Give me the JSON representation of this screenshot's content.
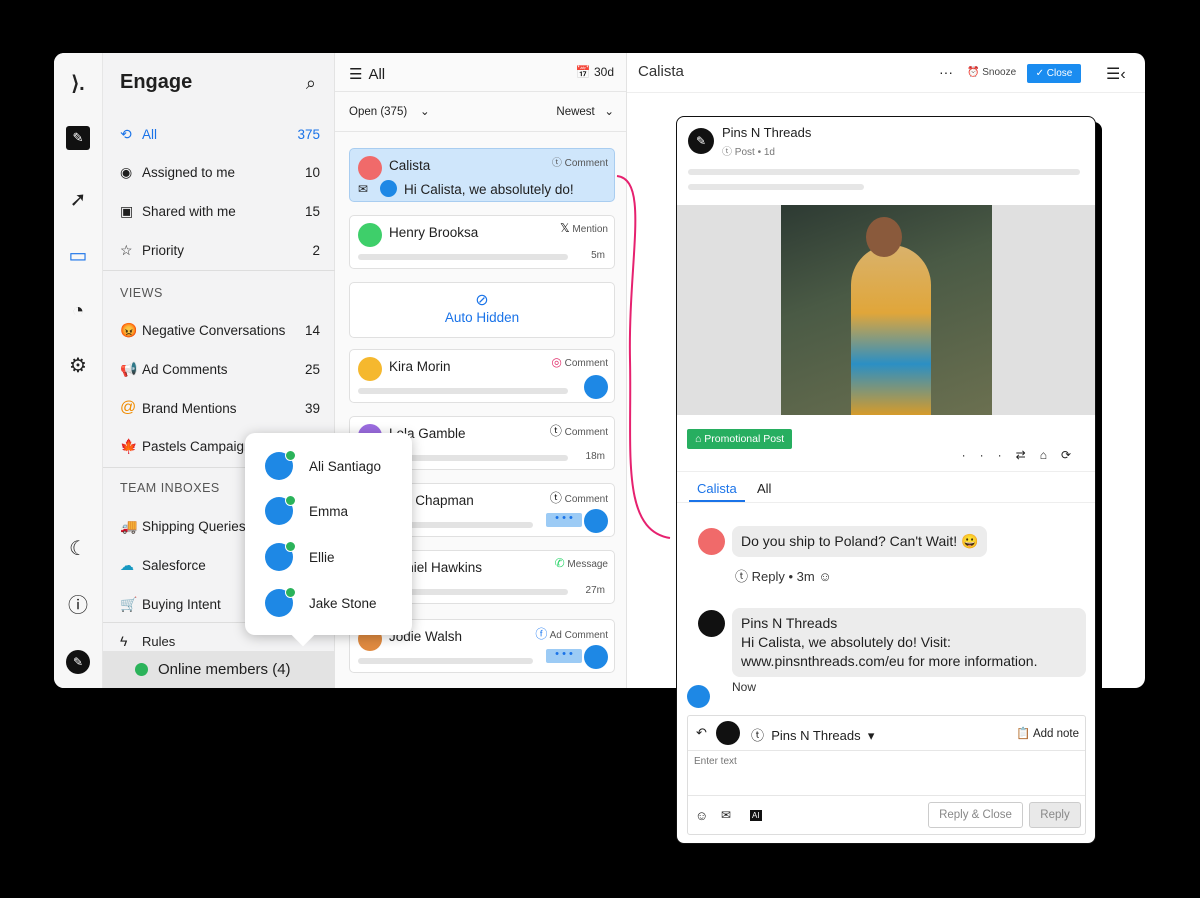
{
  "sidebar": {
    "title": "Engage",
    "items": [
      {
        "label": "All",
        "count": "375"
      },
      {
        "label": "Assigned to me",
        "count": "10"
      },
      {
        "label": "Shared with me",
        "count": "15"
      },
      {
        "label": "Priority",
        "count": "2"
      }
    ],
    "views_heading": "VIEWS",
    "views": [
      {
        "label": "Negative Conversations",
        "count": "14",
        "icon": "😡"
      },
      {
        "label": "Ad Comments",
        "count": "25",
        "icon": "📢"
      },
      {
        "label": "Brand Mentions",
        "count": "39",
        "icon": "@"
      },
      {
        "label": "Pastels Campaign",
        "count": "",
        "icon": "🍁"
      }
    ],
    "team_heading": "TEAM INBOXES",
    "teams": [
      {
        "label": "Shipping Queries"
      },
      {
        "label": "Salesforce"
      },
      {
        "label": "Buying Intent"
      }
    ],
    "rules": "Rules",
    "online": "Online members (4)"
  },
  "popover": {
    "members": [
      "Ali Santiago",
      "Emma",
      "Ellie",
      "Jake Stone"
    ]
  },
  "list": {
    "title": "All",
    "range": "30d",
    "filter": "Open (375)",
    "sort": "Newest",
    "selected": {
      "name": "Calista",
      "source": "Comment",
      "reply": "Hi Calista, we absolutely do!"
    },
    "auto_hidden": "Auto Hidden",
    "cards": [
      {
        "name": "Henry Brooksa",
        "source": "Mention",
        "time": "5m"
      },
      {
        "name": "Kira Morin",
        "source": "Comment",
        "time": ""
      },
      {
        "name": "Lola Gamble",
        "source": "Comment",
        "time": "18m"
      },
      {
        "name": "Elle Chapman",
        "source": "Comment",
        "time": ""
      },
      {
        "name": "Daniel Hawkins",
        "source": "Message",
        "time": "27m"
      },
      {
        "name": "Jodie Walsh",
        "source": "Ad Comment",
        "time": ""
      }
    ]
  },
  "detail": {
    "title": "Calista",
    "snooze": "Snooze",
    "close": "Close"
  },
  "post": {
    "author": "Pins N Threads",
    "meta": "Post • 1d",
    "tag": "Promotional Post",
    "tabs": [
      "Calista",
      "All"
    ],
    "msg1": "Do you ship to Poland? Can't Wait! 😀",
    "reply": "Reply",
    "time1": "3m",
    "msg2_author": "Pins N Threads",
    "msg2": "Hi Calista, we absolutely do! Visit: www.pinsnthreads.com/eu for more information.",
    "time2": "Now",
    "composer": {
      "account": "Pins N Threads",
      "add_note": "Add note",
      "placeholder": "Enter text",
      "reply_close": "Reply & Close",
      "reply": "Reply",
      "ai": "AI"
    }
  },
  "colors": {
    "accent": "#1a73e8",
    "selected": "#cfe6fb",
    "online": "#2bb35a",
    "tag": "#27ae60",
    "connector": "#e6216f"
  }
}
